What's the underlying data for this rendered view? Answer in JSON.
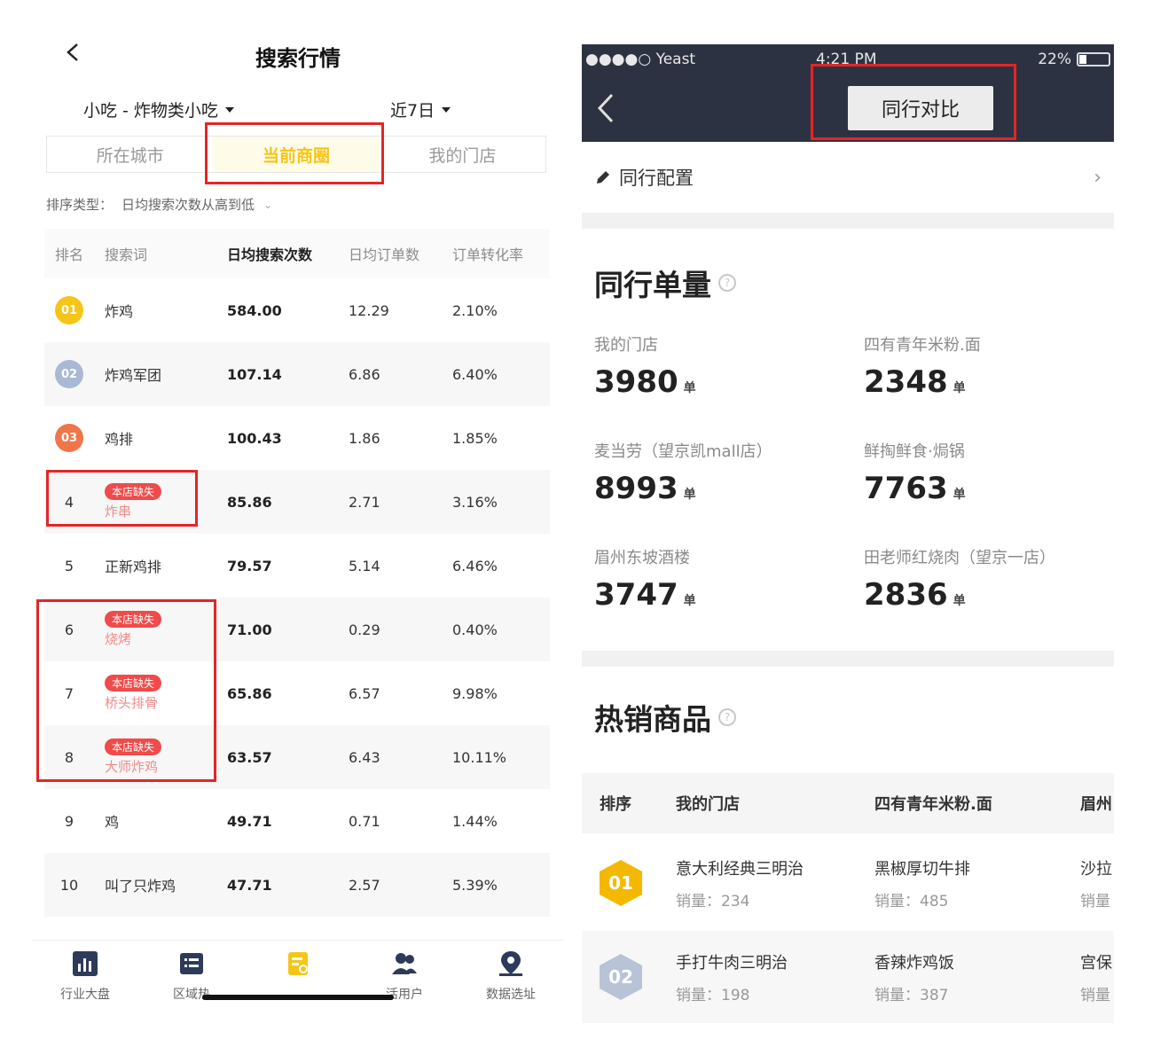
{
  "left": {
    "title": "搜索行情",
    "category_filter": "小吃 - 炸物类小吃",
    "period_filter": "近7日",
    "tabs": [
      "所在城市",
      "当前商圈",
      "我的门店"
    ],
    "sort_label": "排序类型：",
    "sort_value": "日均搜索次数从高到低",
    "table": {
      "headers": [
        "排名",
        "搜索词",
        "日均搜索次数",
        "日均订单数",
        "订单转化率"
      ],
      "rows": [
        {
          "rank": "01",
          "word": "炸鸡",
          "searches": "584.00",
          "orders": "12.29",
          "rate": "2.10%"
        },
        {
          "rank": "02",
          "word": "炸鸡军团",
          "searches": "107.14",
          "orders": "6.86",
          "rate": "6.40%"
        },
        {
          "rank": "03",
          "word": "鸡排",
          "searches": "100.43",
          "orders": "1.86",
          "rate": "1.85%"
        },
        {
          "rank": "4",
          "badge": "本店缺失",
          "word": "炸串",
          "searches": "85.86",
          "orders": "2.71",
          "rate": "3.16%"
        },
        {
          "rank": "5",
          "word": "正新鸡排",
          "searches": "79.57",
          "orders": "5.14",
          "rate": "6.46%"
        },
        {
          "rank": "6",
          "badge": "本店缺失",
          "word": "烧烤",
          "searches": "71.00",
          "orders": "0.29",
          "rate": "0.40%"
        },
        {
          "rank": "7",
          "badge": "本店缺失",
          "word": "桥头排骨",
          "searches": "65.86",
          "orders": "6.57",
          "rate": "9.98%"
        },
        {
          "rank": "8",
          "badge": "本店缺失",
          "word": "大师炸鸡",
          "searches": "63.57",
          "orders": "6.43",
          "rate": "10.11%"
        },
        {
          "rank": "9",
          "word": "鸡",
          "searches": "49.71",
          "orders": "0.71",
          "rate": "1.44%"
        },
        {
          "rank": "10",
          "word": "叫了只炸鸡",
          "searches": "47.71",
          "orders": "2.57",
          "rate": "5.39%"
        }
      ]
    },
    "bottom_nav": [
      "行业大盘",
      "区域热",
      "",
      "活用户",
      "数据选址"
    ],
    "colors": {
      "accent": "#f5c518",
      "highlight_box": "#e52525",
      "loss_badge": "#ef4b4b"
    }
  },
  "right": {
    "status": {
      "carrier": "●●●●○ Yeast",
      "time": "4:21 PM",
      "battery": "22%"
    },
    "nav_button": "同行对比",
    "config_label": "同行配置",
    "peer_section_title": "同行单量",
    "unit": "单",
    "peers": [
      {
        "name": "我的门店",
        "value": "3980"
      },
      {
        "name": "四有青年米粉.面",
        "value": "2348"
      },
      {
        "name": "麦当劳（望京凯mall店）",
        "value": "8993"
      },
      {
        "name": "鲜掏鲜食·焗锅",
        "value": "7763"
      },
      {
        "name": "眉州东坡酒楼",
        "value": "3747"
      },
      {
        "name": "田老师红烧肉（望京一店）",
        "value": "2836"
      }
    ],
    "hot_section_title": "热销商品",
    "hot_table": {
      "headers": [
        "排序",
        "我的门店",
        "四有青年米粉.面",
        "眉州"
      ],
      "rows": [
        {
          "rank": "01",
          "p1": "意大利经典三明治",
          "s1": "销量：234",
          "p2": "黑椒厚切牛排",
          "s2": "销量：485",
          "p3": "沙拉",
          "s3": "销量"
        },
        {
          "rank": "02",
          "p1": "手打牛肉三明治",
          "s1": "销量：198",
          "p2": "香辣炸鸡饭",
          "s2": "销量：387",
          "p3": "宫保",
          "s3": "销量"
        }
      ]
    },
    "colors": {
      "navbar": "#2d3242",
      "highlight_box": "#e52525"
    }
  }
}
